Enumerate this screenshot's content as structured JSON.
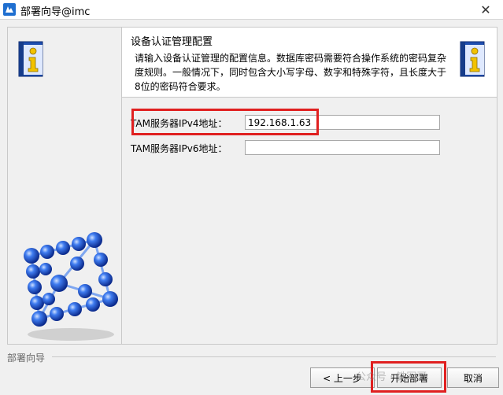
{
  "window": {
    "title": "部署向导@imc",
    "close_glyph": "✕"
  },
  "header": {
    "title": "设备认证管理配置",
    "description": "请输入设备认证管理的配置信息。数据库密码需要符合操作系统的密码复杂度规则。一般情况下，同时包含大小写字母、数字和特殊字符，且长度大于8位的密码符合要求。"
  },
  "form": {
    "ipv4_label": "TAM服务器IPv4地址：",
    "ipv4_value": "192.168.1.63",
    "ipv6_label": "TAM服务器IPv6地址：",
    "ipv6_value": ""
  },
  "footer": {
    "group_label": "部署向导",
    "prev_label": "< 上一步",
    "start_label": "开始部署",
    "cancel_label": "取消"
  },
  "watermark": "公众号 · 铁军哥",
  "colors": {
    "highlight": "#e02020",
    "icon_blue": "#1f4fb0",
    "icon_yellow": "#f2c200",
    "sphere_blue": "#1e5fd6"
  },
  "icons": [
    "app-icon",
    "close-icon",
    "info-book-icon",
    "molecule-cube-graphic"
  ]
}
